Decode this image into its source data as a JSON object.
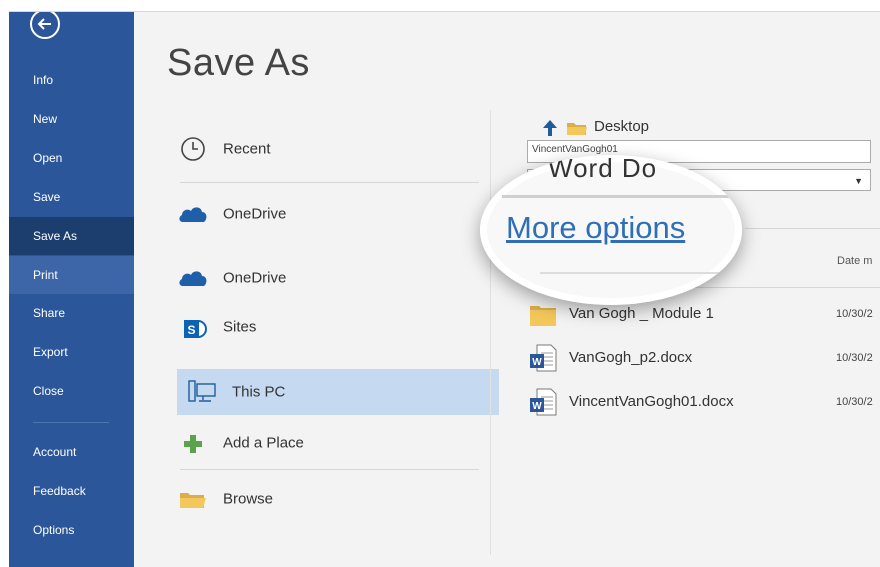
{
  "sidebar": {
    "items": [
      {
        "label": "Info"
      },
      {
        "label": "New"
      },
      {
        "label": "Open"
      },
      {
        "label": "Save"
      },
      {
        "label": "Save As"
      },
      {
        "label": "Print"
      },
      {
        "label": "Share"
      },
      {
        "label": "Export"
      },
      {
        "label": "Close"
      },
      {
        "label": "Account"
      },
      {
        "label": "Feedback"
      },
      {
        "label": "Options"
      }
    ],
    "active": "Save As",
    "hovered": "Print",
    "color": "#2b579a"
  },
  "page_title": "Save As",
  "locations": [
    {
      "label": "Recent",
      "icon": "clock-icon"
    },
    {
      "label": "OneDrive",
      "icon": "cloud-icon"
    },
    {
      "label": "OneDrive",
      "icon": "cloud-icon"
    },
    {
      "label": "Sites",
      "icon": "sharepoint-icon"
    },
    {
      "label": "This PC",
      "icon": "computer-icon",
      "selected": true
    },
    {
      "label": "Add a Place",
      "icon": "plus-icon"
    },
    {
      "label": "Browse",
      "icon": "folder-icon"
    }
  ],
  "right_pane": {
    "current_folder": "Desktop",
    "file_name_value": "VincentVanGogh01",
    "more_options_label": "More options",
    "magnifier_partial_text": "Word Do",
    "date_column_header": "Date m",
    "files": [
      {
        "name": "Van Gogh _ Module 1",
        "date": "10/30/2",
        "icon": "folder-icon"
      },
      {
        "name": "VanGogh_p2.docx",
        "date": "10/30/2",
        "icon": "word-doc-icon"
      },
      {
        "name": "VincentVanGogh01.docx",
        "date": "10/30/2",
        "icon": "word-doc-icon"
      }
    ]
  }
}
